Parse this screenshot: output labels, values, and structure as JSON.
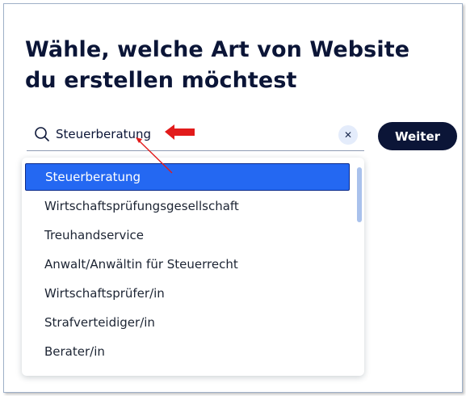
{
  "heading": "Wähle, welche Art von Website du erstellen möchtest",
  "search": {
    "value": "Steuerberatung",
    "clear_label": "✕"
  },
  "next_button": "Weiter",
  "options": [
    "Steuerberatung",
    "Wirtschaftsprüfungsgesellschaft",
    "Treuhandservice",
    "Anwalt/Anwältin für Steuerrecht",
    "Wirtschaftsprüfer/in",
    "Strafverteidiger/in",
    "Berater/in"
  ],
  "selected_option": "Steuerberatung",
  "colors": {
    "selected_bg": "#2468f2",
    "button_bg": "#0b1537",
    "annotation_red": "#e21b1b"
  }
}
